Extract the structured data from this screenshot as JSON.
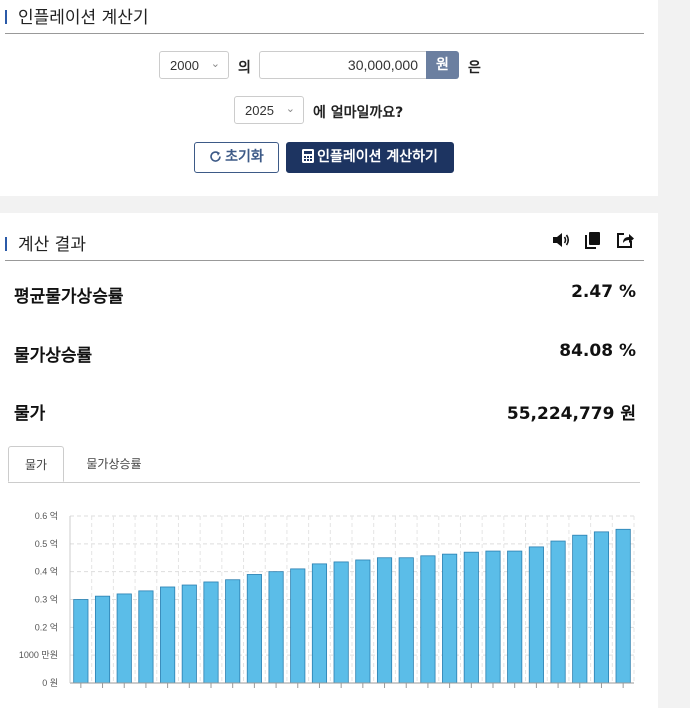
{
  "calculator": {
    "title": "인플레이션 계산기",
    "from_year": "2000",
    "particle_of": "의",
    "amount": "30,000,000",
    "currency_unit": "원",
    "particle_topic": "은",
    "to_year": "2025",
    "question": "에 얼마일까요?",
    "reset_label": "초기화",
    "calculate_label": "인플레이션 계산하기"
  },
  "result": {
    "title": "계산 결과",
    "rows": [
      {
        "label": "평균물가상승률",
        "value": "2.47 %"
      },
      {
        "label": "물가상승률",
        "value": "84.08 %"
      },
      {
        "label": "물가",
        "value": "55,224,779 원"
      }
    ],
    "tabs": [
      {
        "label": "물가",
        "active": true
      },
      {
        "label": "물가상승률",
        "active": false
      }
    ]
  },
  "colors": {
    "accent": "#2b5aa8",
    "primary_button": "#1d3461",
    "won_addon": "#6b7fa0",
    "bar_fill": "#5bbde8",
    "bar_stroke": "#2a7fb0"
  },
  "chart_data": {
    "type": "bar",
    "ylim": [
      0,
      60000000
    ],
    "y_ticks": [
      {
        "value": 0,
        "label": "0 원"
      },
      {
        "value": 10000000,
        "label": "1000 만원"
      },
      {
        "value": 20000000,
        "label": "0.2 억"
      },
      {
        "value": 30000000,
        "label": "0.3 억"
      },
      {
        "value": 40000000,
        "label": "0.4 억"
      },
      {
        "value": 50000000,
        "label": "0.5 억"
      },
      {
        "value": 60000000,
        "label": "0.6 억"
      }
    ],
    "grid": true,
    "values": [
      30000000,
      31200000,
      32000000,
      33100000,
      34500000,
      35200000,
      36300000,
      37100000,
      39000000,
      40000000,
      41000000,
      42800000,
      43500000,
      44200000,
      45000000,
      45000000,
      45700000,
      46300000,
      47000000,
      47400000,
      47400000,
      48900000,
      51000000,
      53100000,
      54300000,
      55224779
    ]
  }
}
